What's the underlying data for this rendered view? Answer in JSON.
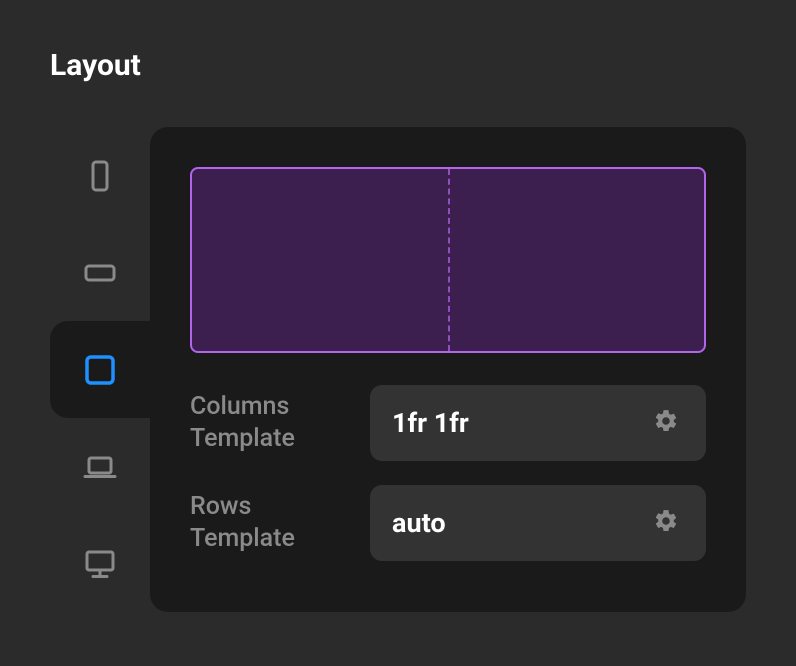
{
  "title": "Layout",
  "devices": [
    {
      "name": "phone-portrait",
      "active": false
    },
    {
      "name": "phone-landscape",
      "active": false
    },
    {
      "name": "tablet",
      "active": true
    },
    {
      "name": "laptop",
      "active": false
    },
    {
      "name": "desktop",
      "active": false
    }
  ],
  "columns": {
    "label": "Columns Template",
    "value": "1fr 1fr"
  },
  "rows": {
    "label": "Rows Template",
    "value": "auto"
  },
  "colors": {
    "inactive_stroke": "#8a8a8a",
    "active_stroke": "#1e90ff",
    "gear": "#8a8a8a"
  }
}
